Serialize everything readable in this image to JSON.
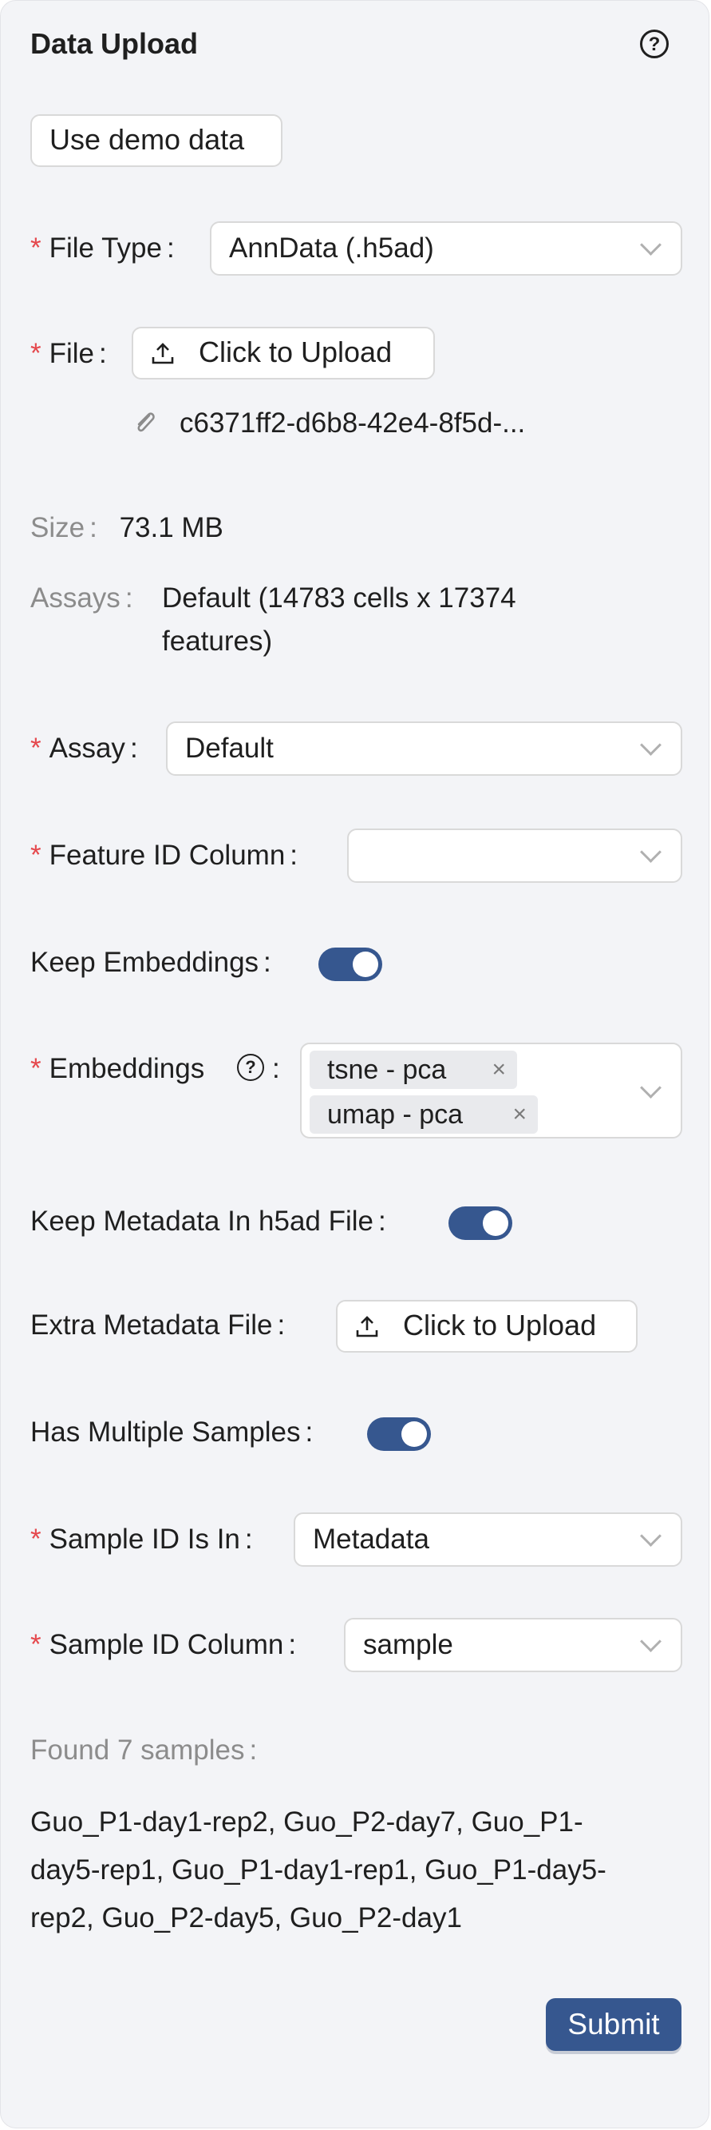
{
  "panel": {
    "title": "Data Upload",
    "help_icon": "question-circle-icon"
  },
  "demo_button": "Use demo data",
  "file_type": {
    "label": "File Type",
    "value": "AnnData (.h5ad)"
  },
  "file": {
    "label": "File",
    "upload_label": "Click to Upload",
    "file_name": "c6371ff2-d6b8-42e4-8f5d-..."
  },
  "size": {
    "label": "Size",
    "value": "73.1 MB"
  },
  "assays_info": {
    "label": "Assays",
    "value_line1": "Default (14783 cells x 17374",
    "value_line2": "features)"
  },
  "assay": {
    "label": "Assay",
    "value": "Default"
  },
  "feature_id": {
    "label": "Feature ID Column",
    "value": ""
  },
  "keep_embeddings": {
    "label": "Keep Embeddings",
    "on": true
  },
  "embeddings": {
    "label": "Embeddings",
    "tags": [
      "tsne - pca",
      "umap - pca"
    ]
  },
  "keep_metadata": {
    "label": "Keep Metadata In h5ad File",
    "on": true
  },
  "extra_metadata": {
    "label": "Extra Metadata File",
    "upload_label": "Click to Upload"
  },
  "multiple_samples": {
    "label": "Has Multiple Samples",
    "on": true
  },
  "sample_id_in": {
    "label": "Sample ID Is In",
    "value": "Metadata"
  },
  "sample_id_column": {
    "label": "Sample ID Column",
    "value": "sample"
  },
  "found": {
    "label": "Found 7 samples",
    "line1": "Guo_P1-day1-rep2, Guo_P2-day7, Guo_P1-",
    "line2": "day5-rep1, Guo_P1-day1-rep1, Guo_P1-day5-",
    "line3": "rep2, Guo_P2-day5, Guo_P2-day1"
  },
  "submit": "Submit",
  "colors": {
    "accent": "#36578f",
    "required": "#e5484d",
    "panel_bg": "#f3f4f7"
  }
}
